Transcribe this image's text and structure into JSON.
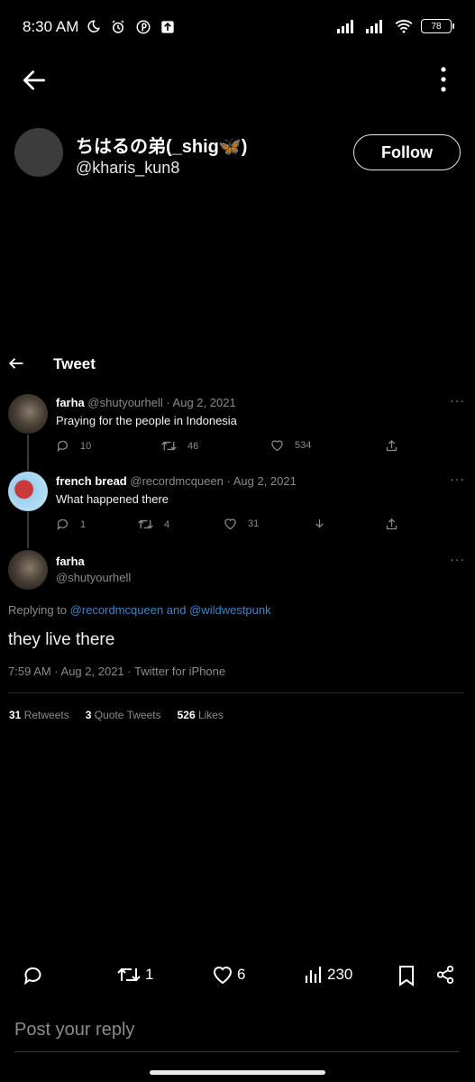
{
  "status_bar": {
    "time": "8:30 AM",
    "battery": "78"
  },
  "profile": {
    "display_name": "ちはるの弟(_shig🦋)",
    "handle": "@kharis_kun8",
    "follow_label": "Follow"
  },
  "embedded": {
    "header_title": "Tweet",
    "tweets": [
      {
        "name": "farha",
        "meta": "@shutyourhell · Aug 2, 2021",
        "text": "Praying for the people in Indonesia",
        "replies": "10",
        "retweets": "46",
        "likes": "534"
      },
      {
        "name": "french bread",
        "meta": "@recordmcqueen · Aug 2, 2021",
        "text": "What happened there",
        "replies": "1",
        "retweets": "4",
        "likes": "31"
      }
    ],
    "main": {
      "name": "farha",
      "handle": "@shutyourhell",
      "replying_prefix": "Replying to",
      "replying_users": "@recordmcqueen and @wildwestpunk",
      "text": "they live there",
      "timestamp": "7:59 AM · Aug 2, 2021 · Twitter for iPhone",
      "retweets_count": "31",
      "retweets_label": "Retweets",
      "quotes_count": "3",
      "quotes_label": "Quote Tweets",
      "likes_count": "526",
      "likes_label": "Likes"
    }
  },
  "actions": {
    "retweets": "1",
    "likes": "6",
    "views": "230"
  },
  "reply": {
    "placeholder": "Post your reply"
  }
}
